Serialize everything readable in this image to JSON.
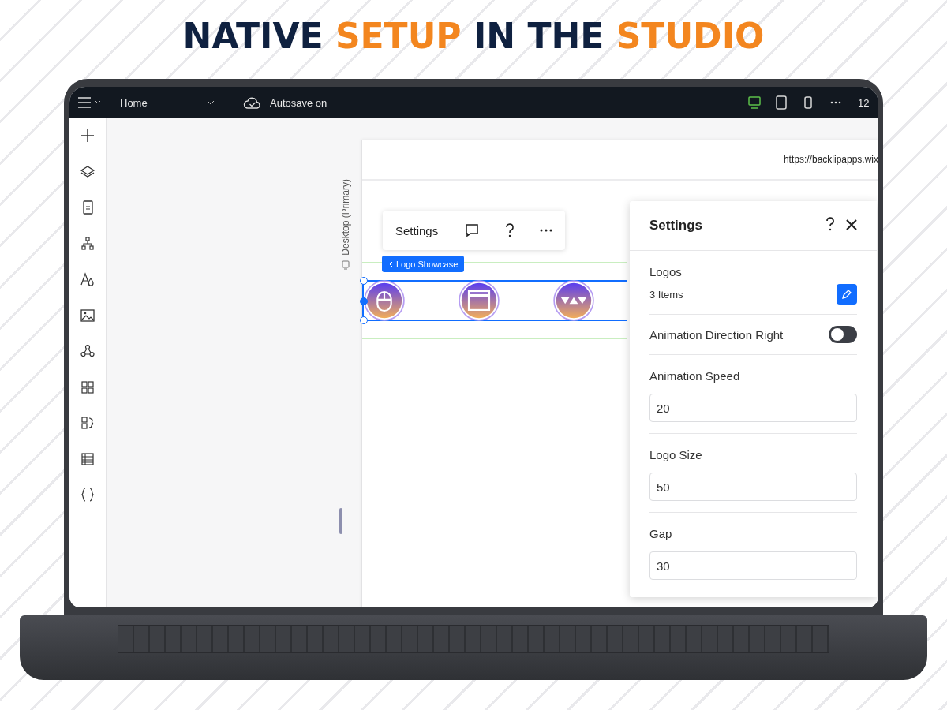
{
  "headline": {
    "parts": [
      {
        "text": "NATIVE ",
        "highlighted": false
      },
      {
        "text": "SETUP",
        "highlighted": true
      },
      {
        "text": " IN THE ",
        "highlighted": false
      },
      {
        "text": "STUDIO",
        "highlighted": true
      }
    ]
  },
  "top_bar": {
    "page": "Home",
    "autosave": "Autosave on",
    "devices": [
      {
        "kind": "desktop",
        "selected": true
      },
      {
        "kind": "tablet",
        "selected": false
      },
      {
        "kind": "mobile",
        "selected": false
      }
    ],
    "zoom": "12"
  },
  "sidebar": {
    "tools": [
      {
        "kind": "add"
      },
      {
        "kind": "layers"
      },
      {
        "kind": "page"
      },
      {
        "kind": "sitemap"
      },
      {
        "kind": "theme"
      },
      {
        "kind": "image"
      },
      {
        "kind": "nodes"
      },
      {
        "kind": "grid"
      },
      {
        "kind": "apps"
      },
      {
        "kind": "table"
      },
      {
        "kind": "code"
      }
    ]
  },
  "canvas": {
    "breakpoint_label": "Desktop (Primary)",
    "url": "https://backlipapps.wix",
    "toolbar_settings": "Settings",
    "element_tag": "Logo Showcase",
    "logos": [
      {
        "kind": "mouse"
      },
      {
        "kind": "window"
      },
      {
        "kind": "triangles"
      }
    ]
  },
  "settings_panel": {
    "title": "Settings",
    "logos_label": "Logos",
    "logos_count": "3 Items",
    "direction_label": "Animation Direction Right",
    "direction_on": false,
    "fields": [
      {
        "label": "Animation Speed",
        "value": "20"
      },
      {
        "label": "Logo Size",
        "value": "50"
      },
      {
        "label": "Gap",
        "value": "30"
      }
    ]
  }
}
